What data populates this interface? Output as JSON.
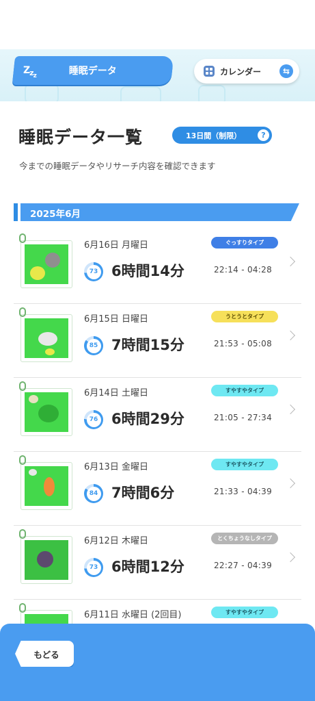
{
  "header": {
    "tab_label": "睡眠データ",
    "zzz": [
      "Z",
      "z",
      "z"
    ],
    "calendar_label": "カレンダー",
    "swap_icon": "⇆"
  },
  "title": {
    "text": "睡眠データ一覧",
    "days_badge": "13日間（制限）",
    "help": "?"
  },
  "subtitle": "今までの睡眠データやリサーチ内容を確認できます",
  "month": "2025年6月",
  "records": [
    {
      "date": "6月16日 月曜日",
      "score": "73",
      "score_pct": 73,
      "duration": "6時間14分",
      "type": "ぐっすりタイプ",
      "type_color": "#3f7fe6",
      "type_text_color": "#ffffff",
      "time": "22:14 - 04:28"
    },
    {
      "date": "6月15日 日曜日",
      "score": "85",
      "score_pct": 85,
      "duration": "7時間15分",
      "type": "うとうとタイプ",
      "type_color": "#f6e05a",
      "type_text_color": "#5a4a00",
      "time": "21:53 - 05:08"
    },
    {
      "date": "6月14日 土曜日",
      "score": "76",
      "score_pct": 76,
      "duration": "6時間29分",
      "type": "すやすやタイプ",
      "type_color": "#6ee8f2",
      "type_text_color": "#1c5a66",
      "time": "21:05 - 27:34"
    },
    {
      "date": "6月13日 金曜日",
      "score": "84",
      "score_pct": 84,
      "duration": "7時間6分",
      "type": "すやすやタイプ",
      "type_color": "#6ee8f2",
      "type_text_color": "#1c5a66",
      "time": "21:33 - 04:39"
    },
    {
      "date": "6月12日 木曜日",
      "score": "73",
      "score_pct": 73,
      "duration": "6時間12分",
      "type": "とくちょうなしタイプ",
      "type_color": "#b5b5b5",
      "type_text_color": "#ffffff",
      "time": "22:27 - 04:39"
    },
    {
      "date": "6月11日 水曜日 (2回目)",
      "score": "",
      "score_pct": 0,
      "duration": "",
      "type": "すやすやタイプ",
      "type_color": "#6ee8f2",
      "type_text_color": "#1c5a66",
      "time": ""
    }
  ],
  "back_label": "もどる"
}
